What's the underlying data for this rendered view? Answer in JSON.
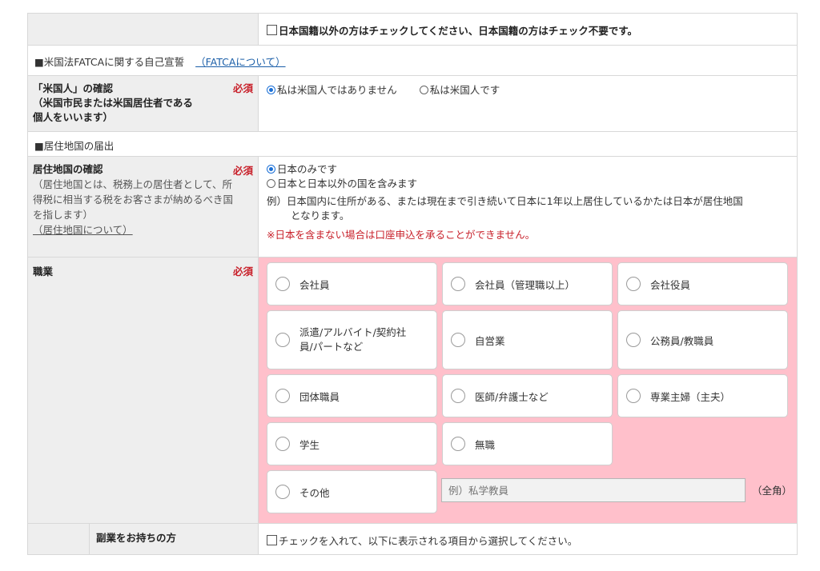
{
  "nationality": {
    "checkbox_label": "日本国籍以外の方はチェックしてください、日本国籍の方はチェック不要です。"
  },
  "fatca_section": {
    "title": "■米国法FATCAに関する自己宣誓",
    "link": "（FATCAについて）"
  },
  "us_person": {
    "label_line1": "「米国人」の確認",
    "label_line2": "（米国市民または米国居住者である",
    "label_line3": "個人をいいます）",
    "required": "必須",
    "options": [
      "私は米国人ではありません",
      "私は米国人です"
    ],
    "selected_index": 0
  },
  "residence_section": {
    "title": "■居住地国の届出"
  },
  "residence": {
    "label": "居住地国の確認",
    "required": "必須",
    "note_line1": "（居住地国とは、税務上の居住者として、所",
    "note_line2": "得税に相当する税をお客さまが納めるべき国",
    "note_line3": "を指します）",
    "link": "（居住地国について）",
    "options": [
      "日本のみです",
      "日本と日本以外の国を含みます"
    ],
    "selected_index": 0,
    "example_line1": "例）日本国内に住所がある、または現在まで引き続いて日本に1年以上居住しているかたは日本が居住地国",
    "example_line2": "となります。",
    "warning": "※日本を含まない場合は口座申込を承ることができません。"
  },
  "occupation": {
    "label": "職業",
    "required": "必須",
    "options": [
      "会社員",
      "会社員（管理職以上）",
      "会社役員",
      "派遣/アルバイト/契約社員/パートなど",
      "自営業",
      "公務員/教職員",
      "団体職員",
      "医師/弁護士など",
      "専業主婦（主夫）",
      "学生",
      "無職",
      "その他"
    ],
    "opt4_line1": "派遣/アルバイト/契約社",
    "opt4_line2": "員/パートなど",
    "other_placeholder": "例）私学教員",
    "other_suffix": "（全角）"
  },
  "side_job": {
    "label": "副業をお持ちの方",
    "checkbox_label": "チェックを入れて、以下に表示される項目から選択してください。"
  },
  "colors": {
    "required_red": "#c8202a",
    "pink_background": "#ffc0cb",
    "label_background": "#eeeeee",
    "link_blue": "#1a5ea8",
    "radio_selected": "#1a6fd6"
  }
}
